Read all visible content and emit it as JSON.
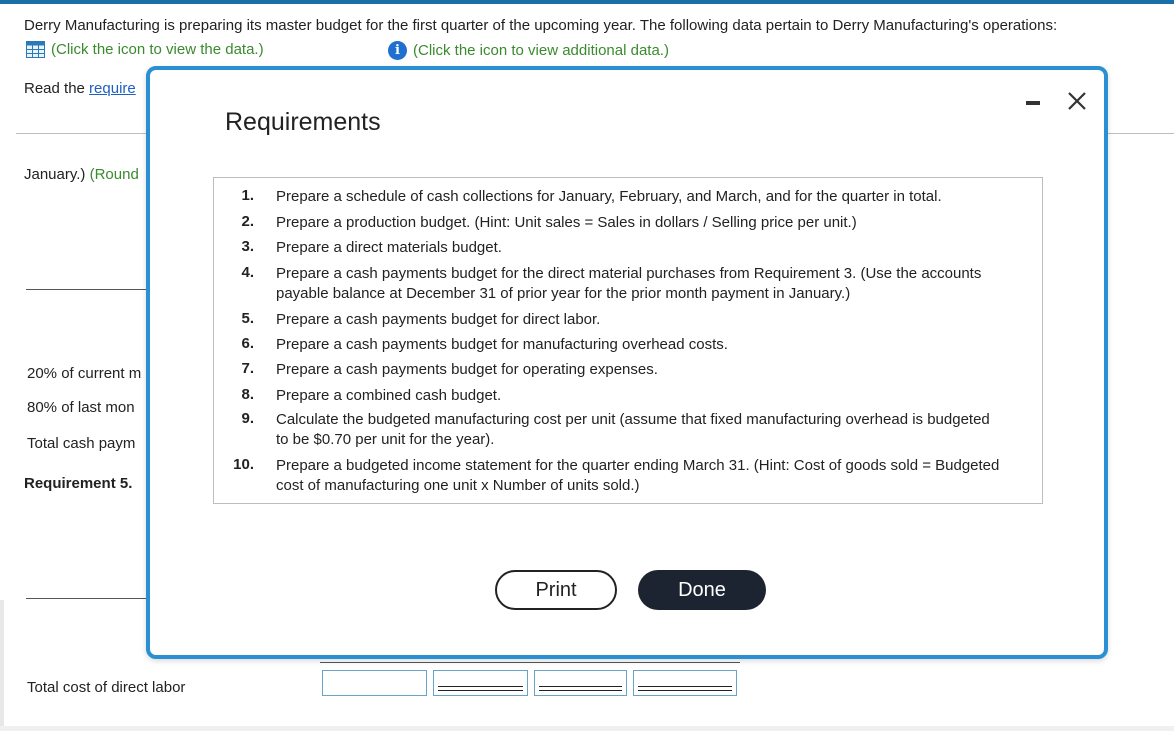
{
  "intro_text": "Derry Manufacturing is preparing its master budget for the first quarter of the upcoming year. The following data pertain to Derry Manufacturing's operations:",
  "links": {
    "data_link": "(Click the icon to view the data.)",
    "additional_link": "(Click the icon to view additional data.)"
  },
  "read_requirements": {
    "prefix": "Read the ",
    "link": "require"
  },
  "background": {
    "january_text": "January.)",
    "round_text": "(Round",
    "current_text": "20% of current m",
    "last_month_text": "80% of last mon",
    "total_cash_text": "Total cash paym",
    "requirement5_text": "Requirement 5.",
    "total_labor_text": "Total cost of direct labor"
  },
  "modal": {
    "title": "Requirements",
    "requirements": [
      {
        "num": "1.",
        "text": "Prepare a schedule of cash collections for January, February, and March, and for the quarter in total."
      },
      {
        "num": "2.",
        "text": "Prepare a production budget. (Hint: Unit sales = Sales in dollars / Selling price per unit.)"
      },
      {
        "num": "3.",
        "text": "Prepare a direct materials budget."
      },
      {
        "num": "4.",
        "text": "Prepare a cash payments budget for the direct material purchases from Requirement 3. (Use the accounts payable balance at December 31 of prior year for the prior month payment in January.)"
      },
      {
        "num": "5.",
        "text": "Prepare a cash payments budget for direct labor."
      },
      {
        "num": "6.",
        "text": "Prepare a cash payments budget for manufacturing overhead costs."
      },
      {
        "num": "7.",
        "text": "Prepare a cash payments budget for operating expenses."
      },
      {
        "num": "8.",
        "text": "Prepare a combined cash budget."
      },
      {
        "num": "9.",
        "text": "Calculate the budgeted manufacturing cost per unit (assume that fixed manufacturing overhead is budgeted to be $0.70 per unit for the year)."
      },
      {
        "num": "10.",
        "text": "Prepare a budgeted income statement for the quarter ending March 31. (Hint: Cost of goods sold = Budgeted cost of manufacturing one unit x Number of units sold.)"
      }
    ],
    "print_label": "Print",
    "done_label": "Done"
  },
  "colors": {
    "accent": "#2b8fd4",
    "link_green": "#3a8a2e",
    "done_bg": "#1d2431",
    "info_blue": "#1f6fd1"
  },
  "icons": {
    "data_icon": "table-grid-icon",
    "info_icon": "info-icon",
    "minimize_icon": "minimize-icon",
    "close_icon": "close-icon"
  }
}
